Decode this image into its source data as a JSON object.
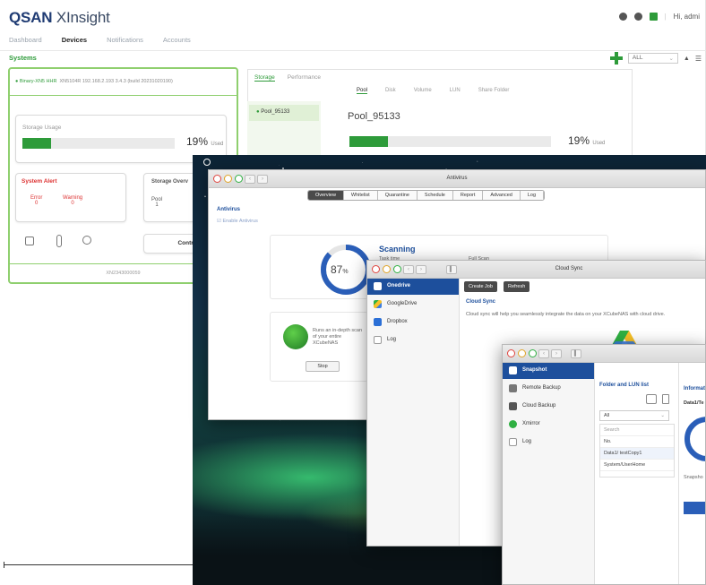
{
  "xinsight": {
    "logo_brand": "QSAN",
    "logo_product": "XInsight",
    "nav": [
      "Dashboard",
      "Devices",
      "Notifications",
      "Accounts"
    ],
    "user_label": "Hi, admi",
    "section_label": "Systems",
    "filter_value": "ALL",
    "system_name": "Binary-XN5 HHR",
    "system_info": "XN5104R  192.168.2.193  3.4.3 (build 20231020190)",
    "storage_usage_title": "Storage Usage",
    "storage_usage_pct": "19%",
    "storage_usage_unit": "Used",
    "system_alert_title": "System Alert",
    "error_label": "Error",
    "error_count": "0",
    "warning_label": "Warning",
    "warning_count": "0",
    "storage_overview_title": "Storage Overv",
    "pool_label": "Pool",
    "pool_count": "1",
    "control_button": "Control",
    "serial": "XN2343000059",
    "tabs": [
      "Storage",
      "Performance"
    ],
    "subtabs": [
      "Pool",
      "Disk",
      "Volume",
      "LUN",
      "Share Folder"
    ],
    "pool_item": "Pool_95133",
    "pool_title": "Pool_95133",
    "pool_pct": "19%",
    "pool_unit": "Used"
  },
  "antivirus": {
    "title": "Antivirus",
    "tabs": [
      "Overview",
      "Whitelist",
      "Quarantine",
      "Schedule",
      "Report",
      "Advanced",
      "Log"
    ],
    "section": "Antivirus",
    "enable_label": "Enable Antivirus",
    "progress_pct": "87",
    "progress_unit": "%",
    "progress_value": 0.87,
    "status_title": "Scanning",
    "task_label": "Task time",
    "fullscan_label": "Full Scan",
    "promo_text": "Runs an in-depth scan of your entire XCubeNAS",
    "stop_button": "Stop"
  },
  "cloudsync": {
    "title": "Cloud Sync",
    "sidebar": [
      "Onedrive",
      "GoogleDrive",
      "Dropbox",
      "Log"
    ],
    "create_job": "Create Job",
    "refresh": "Refresh",
    "heading": "Cloud Sync",
    "description": "Cloud sync will help you seamlessly integrate the data on your XCubeNAS with cloud drive."
  },
  "snapshot": {
    "sidebar": [
      "Snapshot",
      "Remote Backup",
      "Cloud Backup",
      "Xmirror",
      "Log"
    ],
    "folder_title": "Folder and LUN list",
    "filter_value": "All",
    "search_placeholder": "Search",
    "rows": [
      "No.",
      "Data1/ testCopy1",
      "System/UserHome"
    ],
    "info_title": "Informat",
    "info_path": "Data1/Te",
    "snap_label": "Snapsho"
  },
  "colors": {
    "green": "#2e9b3a",
    "blue": "#1d4f9c",
    "alert_red": "#dd3333"
  }
}
